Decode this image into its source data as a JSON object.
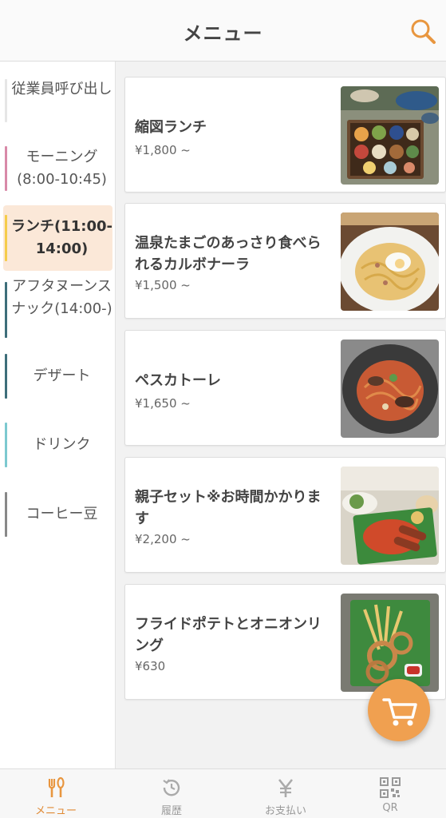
{
  "header": {
    "title": "メニュー",
    "search_icon": "search-icon"
  },
  "sidebar": {
    "items": [
      {
        "label": "従業員呼び出し",
        "bar_color": "#e6e6e6",
        "active": false
      },
      {
        "label": "モーニング(8:00-10:45)",
        "bar_color": "#d889a8",
        "active": false
      },
      {
        "label": "ランチ(11:00-14:00)",
        "bar_color": "#f5cc4a",
        "active": true
      },
      {
        "label": "アフタヌーンスナック(14:00-)",
        "bar_color": "#3d6e7a",
        "active": false
      },
      {
        "label": "デザート",
        "bar_color": "#3d6e7a",
        "active": false
      },
      {
        "label": "ドリンク",
        "bar_color": "#7cc9d0",
        "active": false
      },
      {
        "label": "コーヒー豆",
        "bar_color": "#888888",
        "active": false
      }
    ]
  },
  "menu": {
    "items": [
      {
        "name": "縮図ランチ",
        "price": "¥1,800 ~"
      },
      {
        "name": "温泉たまごのあっさり食べられるカルボナーラ",
        "price": "¥1,500 ~"
      },
      {
        "name": "ペスカトーレ",
        "price": "¥1,650 ~"
      },
      {
        "name": "親子セット※お時間かかります",
        "price": "¥2,200 ~"
      },
      {
        "name": "フライドポテトとオニオンリング",
        "price": "¥630"
      }
    ]
  },
  "cart": {
    "icon": "cart-icon"
  },
  "bottom_nav": {
    "items": [
      {
        "label": "メニュー",
        "icon": "fork-knife-icon",
        "active": true
      },
      {
        "label": "履歴",
        "icon": "history-icon",
        "active": false
      },
      {
        "label": "お支払い",
        "icon": "yen-icon",
        "active": false
      },
      {
        "label": "QR",
        "icon": "qr-icon",
        "active": false
      }
    ]
  },
  "colors": {
    "accent": "#f0a050",
    "active_bg": "#fbe8d8"
  }
}
